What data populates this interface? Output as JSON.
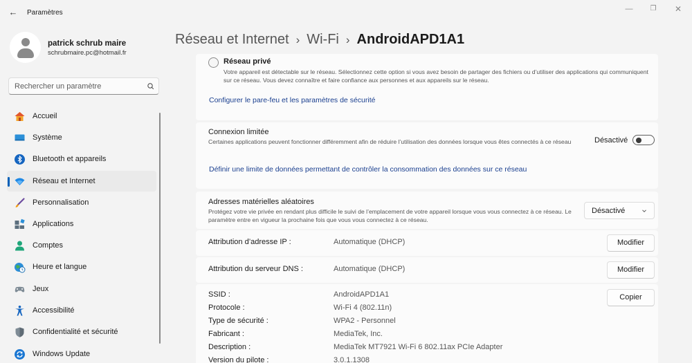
{
  "window": {
    "title": "Paramètres",
    "back": "←",
    "minimize": "—",
    "maximize": "❐",
    "close": "✕"
  },
  "profile": {
    "name": "patrick schrub maire",
    "email": "schrubmaire.pc@hotmail.fr"
  },
  "search": {
    "placeholder": "Rechercher un paramètre"
  },
  "sidebar": {
    "items": [
      {
        "label": "Accueil",
        "icon": "home-icon"
      },
      {
        "label": "Système",
        "icon": "system-icon"
      },
      {
        "label": "Bluetooth et appareils",
        "icon": "bluetooth-icon"
      },
      {
        "label": "Réseau et Internet",
        "icon": "wifi-icon",
        "active": true
      },
      {
        "label": "Personnalisation",
        "icon": "brush-icon"
      },
      {
        "label": "Applications",
        "icon": "apps-icon"
      },
      {
        "label": "Comptes",
        "icon": "accounts-icon"
      },
      {
        "label": "Heure et langue",
        "icon": "globe-clock-icon"
      },
      {
        "label": "Jeux",
        "icon": "gamepad-icon"
      },
      {
        "label": "Accessibilité",
        "icon": "accessibility-icon"
      },
      {
        "label": "Confidentialité et sécurité",
        "icon": "shield-icon"
      },
      {
        "label": "Windows Update",
        "icon": "update-icon"
      }
    ]
  },
  "breadcrumb": {
    "part1": "Réseau et Internet",
    "sep": "›",
    "part2": "Wi-Fi",
    "current": "AndroidAPD1A1"
  },
  "private_network": {
    "label": "Réseau privé",
    "description": "Votre appareil est détectable sur le réseau. Sélectionnez cette option si vous avez besoin de partager des fichiers ou d’utiliser des applications qui communiquent sur ce réseau. Vous devez connaître et faire confiance aux personnes et aux appareils sur le réseau.",
    "firewall_link": "Configurer le pare-feu et les paramètres de sécurité"
  },
  "metered": {
    "title": "Connexion limitée",
    "description": "Certaines applications peuvent fonctionner différemment afin de réduire l’utilisation des données lorsque vous êtes connectés à ce réseau",
    "toggle_label": "Désactivé",
    "toggle_on": false,
    "limit_link": "Définir une limite de données permettant de contrôler la consommation des données sur ce réseau"
  },
  "random_mac": {
    "title": "Adresses matérielles aléatoires",
    "description": "Protégez votre vie privée en rendant plus difficile le suivi de l’emplacement de votre appareil lorsque vous vous connectez à ce réseau. Le paramètre entre en vigueur la prochaine fois que vous vous connectez à ce réseau.",
    "value": "Désactivé"
  },
  "ip": {
    "label": "Attribution d’adresse IP :",
    "value": "Automatique (DHCP)",
    "button": "Modifier"
  },
  "dns": {
    "label": "Attribution du serveur DNS :",
    "value": "Automatique (DHCP)",
    "button": "Modifier"
  },
  "props": {
    "copy_button": "Copier",
    "rows": [
      {
        "label": "SSID :",
        "value": "AndroidAPD1A1"
      },
      {
        "label": "Protocole :",
        "value": "Wi-Fi 4 (802.11n)"
      },
      {
        "label": "Type de sécurité :",
        "value": "WPA2 - Personnel"
      },
      {
        "label": "Fabricant :",
        "value": "MediaTek, Inc."
      },
      {
        "label": "Description :",
        "value": "MediaTek MT7921 Wi-Fi 6 802.11ax PCIe Adapter"
      },
      {
        "label": "Version du pilote :",
        "value": "3.0.1.1308"
      }
    ]
  },
  "colors": {
    "accent": "#005fb8",
    "link": "#1a3f8f",
    "background": "#f3f3f3",
    "card": "#fbfbfb"
  }
}
